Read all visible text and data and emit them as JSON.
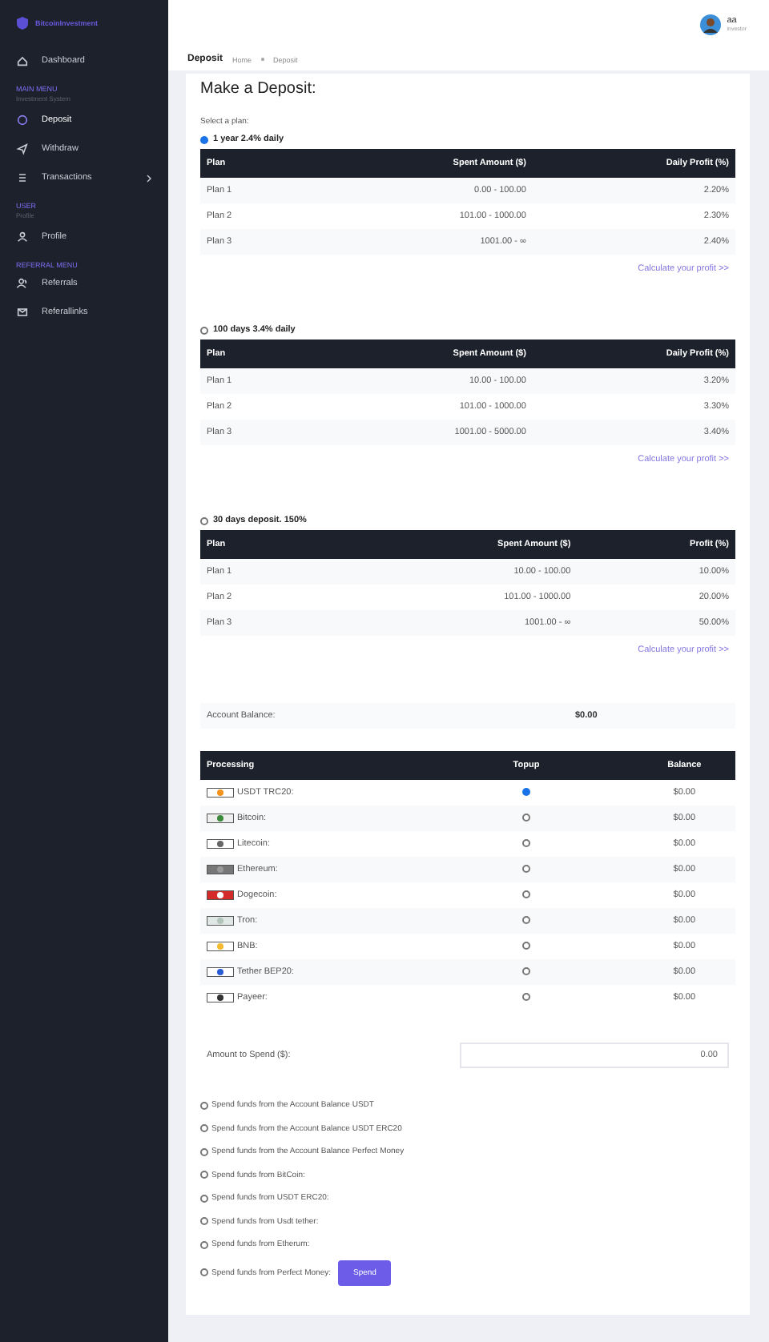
{
  "sidebar": {
    "logo": "BitcoinInvestment",
    "groups": [
      {
        "items": [
          {
            "label": "Dashboard",
            "selected": false,
            "submenu": false
          }
        ]
      },
      {
        "heading": "MAIN MENU",
        "subheading": "Investment System",
        "items": [
          {
            "label": "Deposit",
            "selected": true,
            "submenu": false
          },
          {
            "label": "Withdraw",
            "selected": false,
            "submenu": false
          },
          {
            "label": "Transactions",
            "selected": false,
            "submenu": true
          }
        ]
      },
      {
        "heading": "USER",
        "subheading": "Profile",
        "items": [
          {
            "label": "Profile",
            "selected": false,
            "submenu": false
          }
        ]
      },
      {
        "heading": "REFERRAL MENU",
        "items": [
          {
            "label": "Referrals",
            "selected": false,
            "submenu": false
          },
          {
            "label": "Referallinks",
            "selected": false,
            "submenu": false
          }
        ]
      }
    ]
  },
  "user": {
    "name": "aa",
    "role": "investor"
  },
  "breadcrumb": {
    "title": "Deposit",
    "trail": [
      "Home",
      "Deposit"
    ]
  },
  "heading": "Make a Deposit:",
  "select_label": "Select a plan:",
  "plans": [
    {
      "label": "1 year 2.4% daily",
      "selected": true,
      "columns": [
        "Plan",
        "Spent Amount ($)",
        "Daily Profit (%)"
      ],
      "rows": [
        [
          "Plan 1",
          "0.00 - 100.00",
          "2.20%"
        ],
        [
          "Plan 2",
          "101.00 - 1000.00",
          "2.30%"
        ],
        [
          "Plan 3",
          "1001.00 - ∞",
          "2.40%"
        ]
      ],
      "link": "Calculate your profit >>"
    },
    {
      "label": "100 days 3.4% daily",
      "selected": false,
      "columns": [
        "Plan",
        "Spent Amount ($)",
        "Daily Profit (%)"
      ],
      "rows": [
        [
          "Plan 1",
          "10.00 - 100.00",
          "3.20%"
        ],
        [
          "Plan 2",
          "101.00 - 1000.00",
          "3.30%"
        ],
        [
          "Plan 3",
          "1001.00 - 5000.00",
          "3.40%"
        ]
      ],
      "link": "Calculate your profit >>"
    },
    {
      "label": "30 days deposit. 150%",
      "selected": false,
      "columns": [
        "Plan",
        "Spent Amount ($)",
        "Profit (%)"
      ],
      "rows": [
        [
          "Plan 1",
          "10.00 - 100.00",
          "10.00%"
        ],
        [
          "Plan 2",
          "101.00 - 1000.00",
          "20.00%"
        ],
        [
          "Plan 3",
          "1001.00 - ∞",
          "50.00%"
        ]
      ],
      "link": "Calculate your profit >>"
    }
  ],
  "account_balance": {
    "label": "Account Balance:",
    "value": "$0.00"
  },
  "processing": {
    "columns": [
      "Processing",
      "Topup",
      "Balance"
    ],
    "rows": [
      {
        "name": "USDT TRC20:",
        "selected": true,
        "balance": "$0.00"
      },
      {
        "name": "Bitcoin:",
        "selected": false,
        "balance": "$0.00"
      },
      {
        "name": "Litecoin:",
        "selected": false,
        "balance": "$0.00"
      },
      {
        "name": "Ethereum:",
        "selected": false,
        "balance": "$0.00"
      },
      {
        "name": "Dogecoin:",
        "selected": false,
        "balance": "$0.00"
      },
      {
        "name": "Tron:",
        "selected": false,
        "balance": "$0.00"
      },
      {
        "name": "BNB:",
        "selected": false,
        "balance": "$0.00"
      },
      {
        "name": "Tether BEP20:",
        "selected": false,
        "balance": "$0.00"
      },
      {
        "name": "Payeer:",
        "selected": false,
        "balance": "$0.00"
      }
    ]
  },
  "amount": {
    "label": "Amount to Spend ($):",
    "value": "0.00"
  },
  "spend_options": [
    {
      "label": "Spend funds from the Account Balance USDT",
      "selected": false
    },
    {
      "label": "Spend funds from the Account Balance USDT ERC20",
      "selected": false
    },
    {
      "label": "Spend funds from the Account Balance Perfect Money",
      "selected": false
    },
    {
      "label": "Spend funds from BitCoin:",
      "selected": false
    },
    {
      "label": "Spend funds from USDT ERC20:",
      "selected": false
    },
    {
      "label": "Spend funds from Usdt tether:",
      "selected": false
    },
    {
      "label": "Spend funds from Etherum:",
      "selected": false
    },
    {
      "label": "Spend funds from Perfect Money:",
      "selected": false
    }
  ],
  "spend_button": "Spend"
}
